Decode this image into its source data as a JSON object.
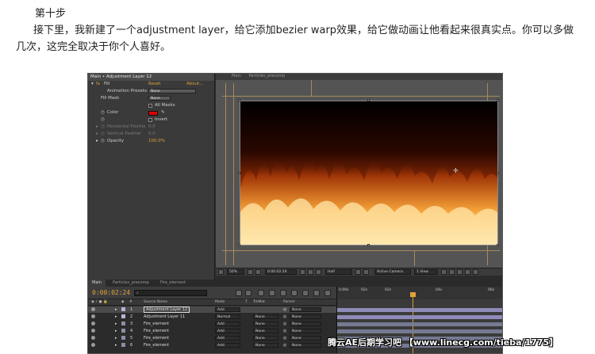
{
  "article": {
    "step_title": "第十步",
    "paragraph": "接下里，我新建了一个adjustment layer，给它添加bezier warp效果，给它做动画让他看起来很真实点。你可以多做几次，这完全取决于你个人喜好。"
  },
  "effect_controls": {
    "header": "Main • Adjustment Layer 12",
    "effect_name": "Fill",
    "reset_label": "Reset",
    "about_label": "About...",
    "animation_presets_label": "Animation Presets:",
    "animation_presets_value": "None",
    "fill_mask_label": "Fill Mask",
    "fill_mask_value": "None",
    "all_masks_label": "All Masks",
    "color_label": "Color",
    "color_value": "#e10000",
    "invert_label": "Invert",
    "horizontal_feather_label": "Horizontal Feathe",
    "horizontal_feather_value": "0,0",
    "vertical_feather_label": "Vertical Feather",
    "vertical_feather_value": "0,0",
    "opacity_label": "Opacity",
    "opacity_value": "100,0%"
  },
  "viewer": {
    "tab_main": "Main",
    "tab_comp": "Particles_precomp"
  },
  "viewer_bar": {
    "zoom": "50%",
    "timecode": "0:00:02:24",
    "resolution": "Half",
    "camera": "Active Camera",
    "view": "1 View"
  },
  "timeline": {
    "tabs": [
      "Main",
      "Particles_precomp",
      "Fire_element"
    ],
    "current_time": "0:00:02:24",
    "search_placeholder": "",
    "ruler_ticks": [
      "0:00s",
      "02s",
      "02s",
      "04s",
      "06s"
    ],
    "columns": {
      "source_name": "Source Name",
      "mode": "Mode",
      "t": "T",
      "trkmat": "TrkMat",
      "parent": "Parent"
    },
    "layers": [
      {
        "num": "1",
        "name": "Adjustment Layer 12",
        "mode": "Add",
        "trkmat": "",
        "parent": "None",
        "color": "#b9b3d6"
      },
      {
        "num": "2",
        "name": "Adjustment Layer 11",
        "mode": "Normal",
        "trkmat": "None",
        "parent": "None",
        "color": "#b9b3d6"
      },
      {
        "num": "3",
        "name": "Fire_element",
        "mode": "Add",
        "trkmat": "None",
        "parent": "None",
        "color": "#8a8fa6"
      },
      {
        "num": "4",
        "name": "Fire_element",
        "mode": "Add",
        "trkmat": "None",
        "parent": "None",
        "color": "#8a8fa6"
      },
      {
        "num": "5",
        "name": "Fire_element",
        "mode": "Add",
        "trkmat": "None",
        "parent": "None",
        "color": "#8a8fa6"
      },
      {
        "num": "6",
        "name": "Fire_element",
        "mode": "Add",
        "trkmat": "None",
        "parent": "None",
        "color": "#8a8fa6"
      }
    ]
  },
  "watermark": "腾云AE后期学习吧 【www.linecg.com/tieba/1775】"
}
